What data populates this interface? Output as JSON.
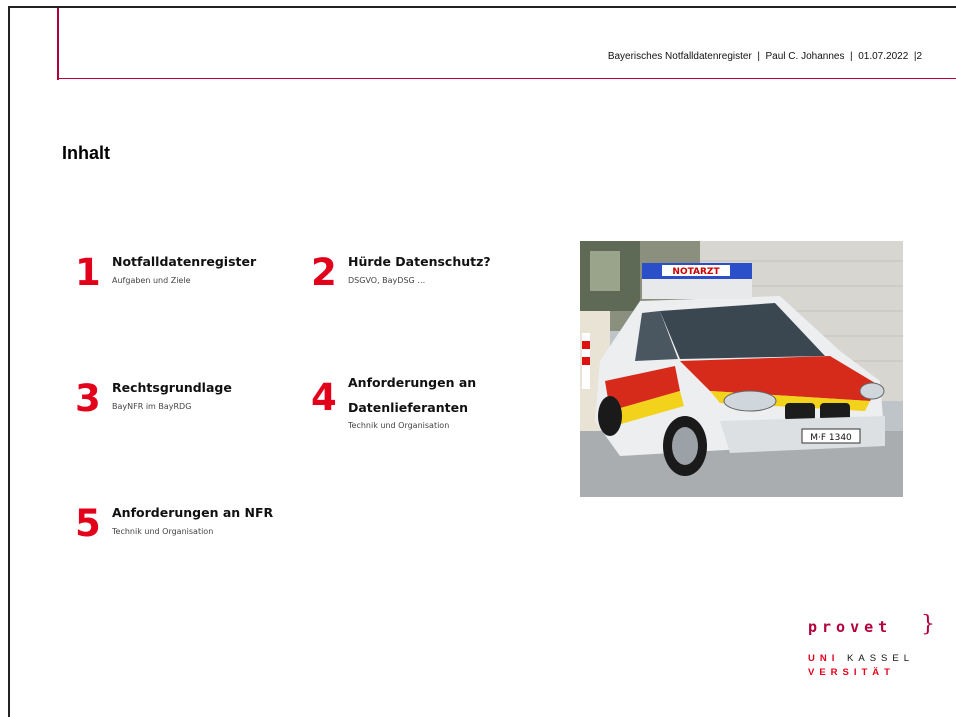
{
  "header": {
    "register": "Bayerisches Notfalldatenregister",
    "author": "Paul C. Johannes",
    "date": "01.07.2022",
    "page": "2",
    "sep": "|"
  },
  "title": "Inhalt",
  "items": [
    {
      "num": "1",
      "head": "Notfalldatenregister",
      "head2": "",
      "sub": "Aufgaben und Ziele"
    },
    {
      "num": "2",
      "head": "Hürde Datenschutz?",
      "head2": "",
      "sub": "DSGVO, BayDSG …"
    },
    {
      "num": "3",
      "head": "Rechtsgrundlage",
      "head2": "",
      "sub": "BayNFR im BayRDG"
    },
    {
      "num": "4",
      "head": "Anforderungen an",
      "head2": "Datenlieferanten",
      "sub": "Technik und Organisation"
    },
    {
      "num": "5",
      "head": "Anforderungen an NFR",
      "head2": "",
      "sub": "Technik und Organisation"
    }
  ],
  "photo": {
    "roof_sign": "NOTARZT",
    "plate": "M·F 1340"
  },
  "logo": {
    "provet": "provet",
    "uni_red_1": "UNI",
    "uni_rest_1": "KASSEL",
    "uni_red_2": "VERSITÄT"
  },
  "colors": {
    "accent": "#b3003c",
    "number_red": "#e3001b"
  }
}
